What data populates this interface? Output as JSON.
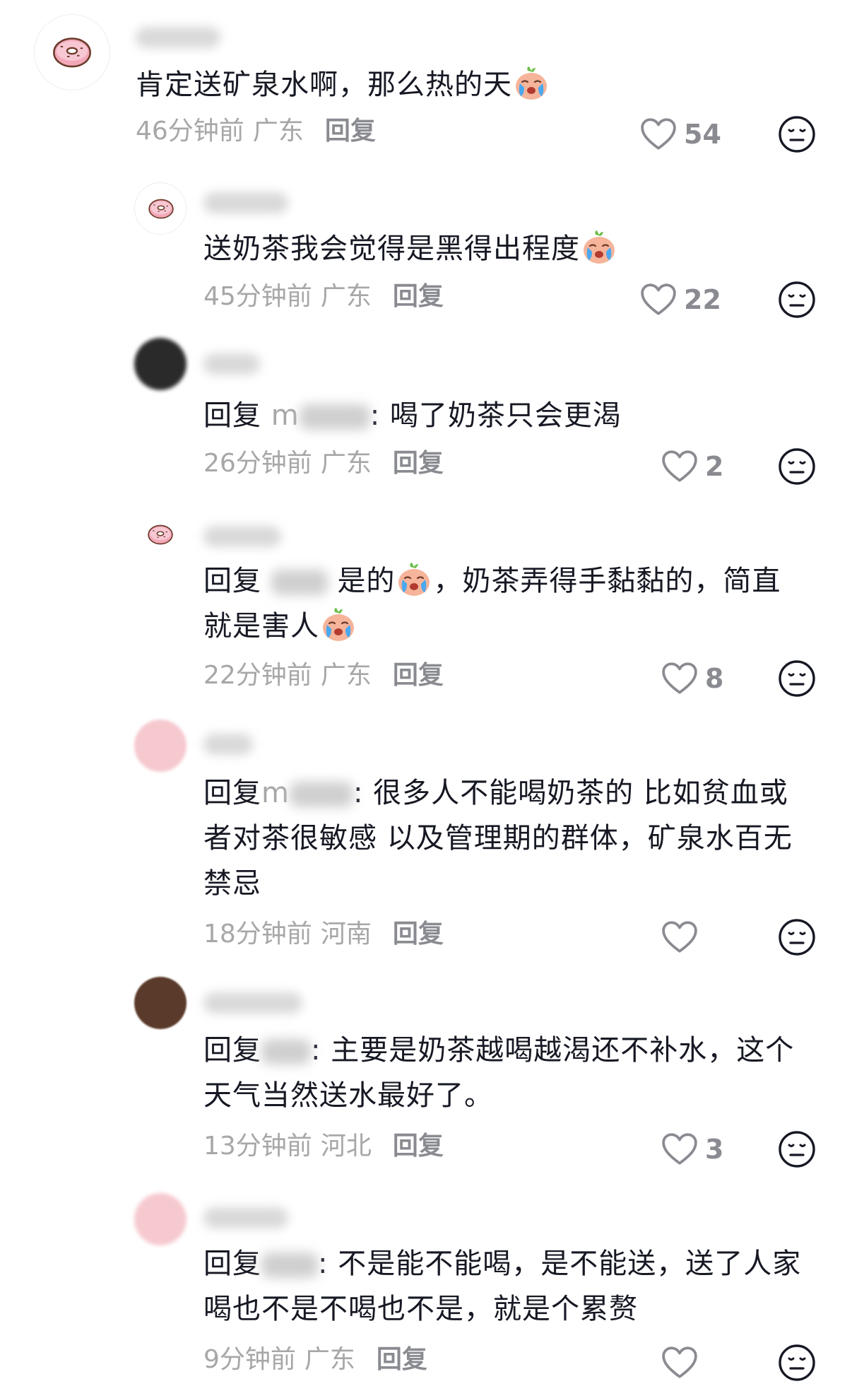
{
  "colors": {
    "text": "#161823",
    "meta": "#a7a7a9",
    "reply": "#8a8b91",
    "icon": "#8a8b91"
  },
  "comments": [
    {
      "text": "肯定送矿泉水啊，那么热的天",
      "time": "46分钟前",
      "region": "广东",
      "reply": "回复",
      "likes": "54"
    },
    {
      "text": "送奶茶我会觉得是黑得出程度",
      "time": "45分钟前",
      "region": "广东",
      "reply": "回复",
      "likes": "22"
    },
    {
      "prefix": "回复",
      "mention": "m",
      "text": ": 喝了奶茶只会更渴",
      "time": "26分钟前",
      "region": "广东",
      "reply": "回复",
      "likes": "2"
    },
    {
      "prefix": "回复",
      "text_a": "是的",
      "text_b": "，奶茶弄得手黏黏的，简直",
      "text_c": "就是害人",
      "time": "22分钟前",
      "region": "广东",
      "reply": "回复",
      "likes": "8"
    },
    {
      "prefix": "回复",
      "mention": "m",
      "line1": ": 很多人不能喝奶茶的 比如贫血或",
      "line2": "者对茶很敏感 以及管理期的群体，矿泉水百无",
      "line3": "禁忌",
      "time": "18分钟前",
      "region": "河南",
      "reply": "回复",
      "likes": ""
    },
    {
      "prefix": "回复",
      "line1": ": 主要是奶茶越喝越渴还不补水，这个",
      "line2": "天气当然送水最好了。",
      "time": "13分钟前",
      "region": "河北",
      "reply": "回复",
      "likes": "3"
    },
    {
      "prefix": "回复",
      "line1": ": 不是能不能喝，是不能送，送了人家",
      "line2": "喝也不是不喝也不是，就是个累赘",
      "time": "9分钟前",
      "region": "广东",
      "reply": "回复",
      "likes": ""
    }
  ],
  "icons": {
    "like": "heart-outline-icon",
    "dislike": "meh-face-icon",
    "emoji": "crying-face-emoji",
    "avatar": "donut-avatar"
  }
}
